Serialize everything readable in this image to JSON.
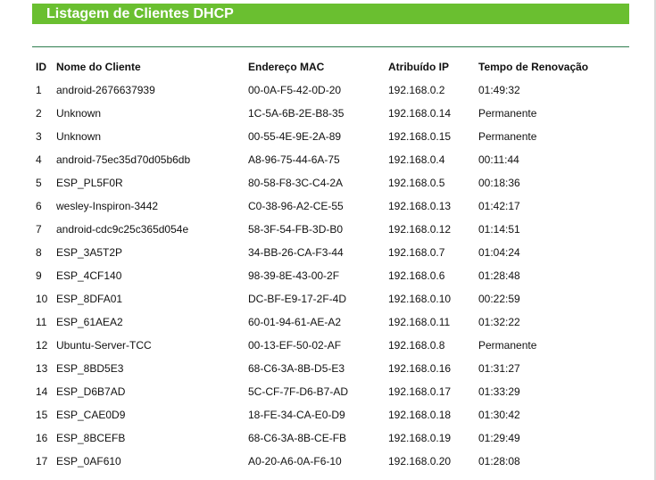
{
  "page_title": "Listagem de Clientes DHCP",
  "columns": [
    "ID",
    "Nome do Cliente",
    "Endereço MAC",
    "Atribuído IP",
    "Tempo de Renovação"
  ],
  "clients": [
    {
      "id": "1",
      "name": "android-2676637939",
      "mac": "00-0A-F5-42-0D-20",
      "ip": "192.168.0.2",
      "lease": "01:49:32"
    },
    {
      "id": "2",
      "name": "Unknown",
      "mac": "1C-5A-6B-2E-B8-35",
      "ip": "192.168.0.14",
      "lease": "Permanente"
    },
    {
      "id": "3",
      "name": "Unknown",
      "mac": "00-55-4E-9E-2A-89",
      "ip": "192.168.0.15",
      "lease": "Permanente"
    },
    {
      "id": "4",
      "name": "android-75ec35d70d05b6db",
      "mac": "A8-96-75-44-6A-75",
      "ip": "192.168.0.4",
      "lease": "00:11:44"
    },
    {
      "id": "5",
      "name": "ESP_PL5F0R",
      "mac": "80-58-F8-3C-C4-2A",
      "ip": "192.168.0.5",
      "lease": "00:18:36"
    },
    {
      "id": "6",
      "name": "wesley-Inspiron-3442",
      "mac": "C0-38-96-A2-CE-55",
      "ip": "192.168.0.13",
      "lease": "01:42:17"
    },
    {
      "id": "7",
      "name": "android-cdc9c25c365d054e",
      "mac": "58-3F-54-FB-3D-B0",
      "ip": "192.168.0.12",
      "lease": "01:14:51"
    },
    {
      "id": "8",
      "name": "ESP_3A5T2P",
      "mac": "34-BB-26-CA-F3-44",
      "ip": "192.168.0.7",
      "lease": "01:04:24"
    },
    {
      "id": "9",
      "name": "ESP_4CF140",
      "mac": "98-39-8E-43-00-2F",
      "ip": "192.168.0.6",
      "lease": "01:28:48"
    },
    {
      "id": "10",
      "name": "ESP_8DFA01",
      "mac": "DC-BF-E9-17-2F-4D",
      "ip": "192.168.0.10",
      "lease": "00:22:59"
    },
    {
      "id": "11",
      "name": "ESP_61AEA2",
      "mac": "60-01-94-61-AE-A2",
      "ip": "192.168.0.11",
      "lease": "01:32:22"
    },
    {
      "id": "12",
      "name": "Ubuntu-Server-TCC",
      "mac": "00-13-EF-50-02-AF",
      "ip": "192.168.0.8",
      "lease": "Permanente"
    },
    {
      "id": "13",
      "name": "ESP_8BD5E3",
      "mac": "68-C6-3A-8B-D5-E3",
      "ip": "192.168.0.16",
      "lease": "01:31:27"
    },
    {
      "id": "14",
      "name": "ESP_D6B7AD",
      "mac": "5C-CF-7F-D6-B7-AD",
      "ip": "192.168.0.17",
      "lease": "01:33:29"
    },
    {
      "id": "15",
      "name": "ESP_CAE0D9",
      "mac": "18-FE-34-CA-E0-D9",
      "ip": "192.168.0.18",
      "lease": "01:30:42"
    },
    {
      "id": "16",
      "name": "ESP_8BCEFB",
      "mac": "68-C6-3A-8B-CE-FB",
      "ip": "192.168.0.19",
      "lease": "01:29:49"
    },
    {
      "id": "17",
      "name": "ESP_0AF610",
      "mac": "A0-20-A6-0A-F6-10",
      "ip": "192.168.0.20",
      "lease": "01:28:08"
    }
  ],
  "colors": {
    "header_bg": "#6abf30",
    "header_text": "#ffffff",
    "divider": "#2e7d4f",
    "text": "#111111"
  }
}
